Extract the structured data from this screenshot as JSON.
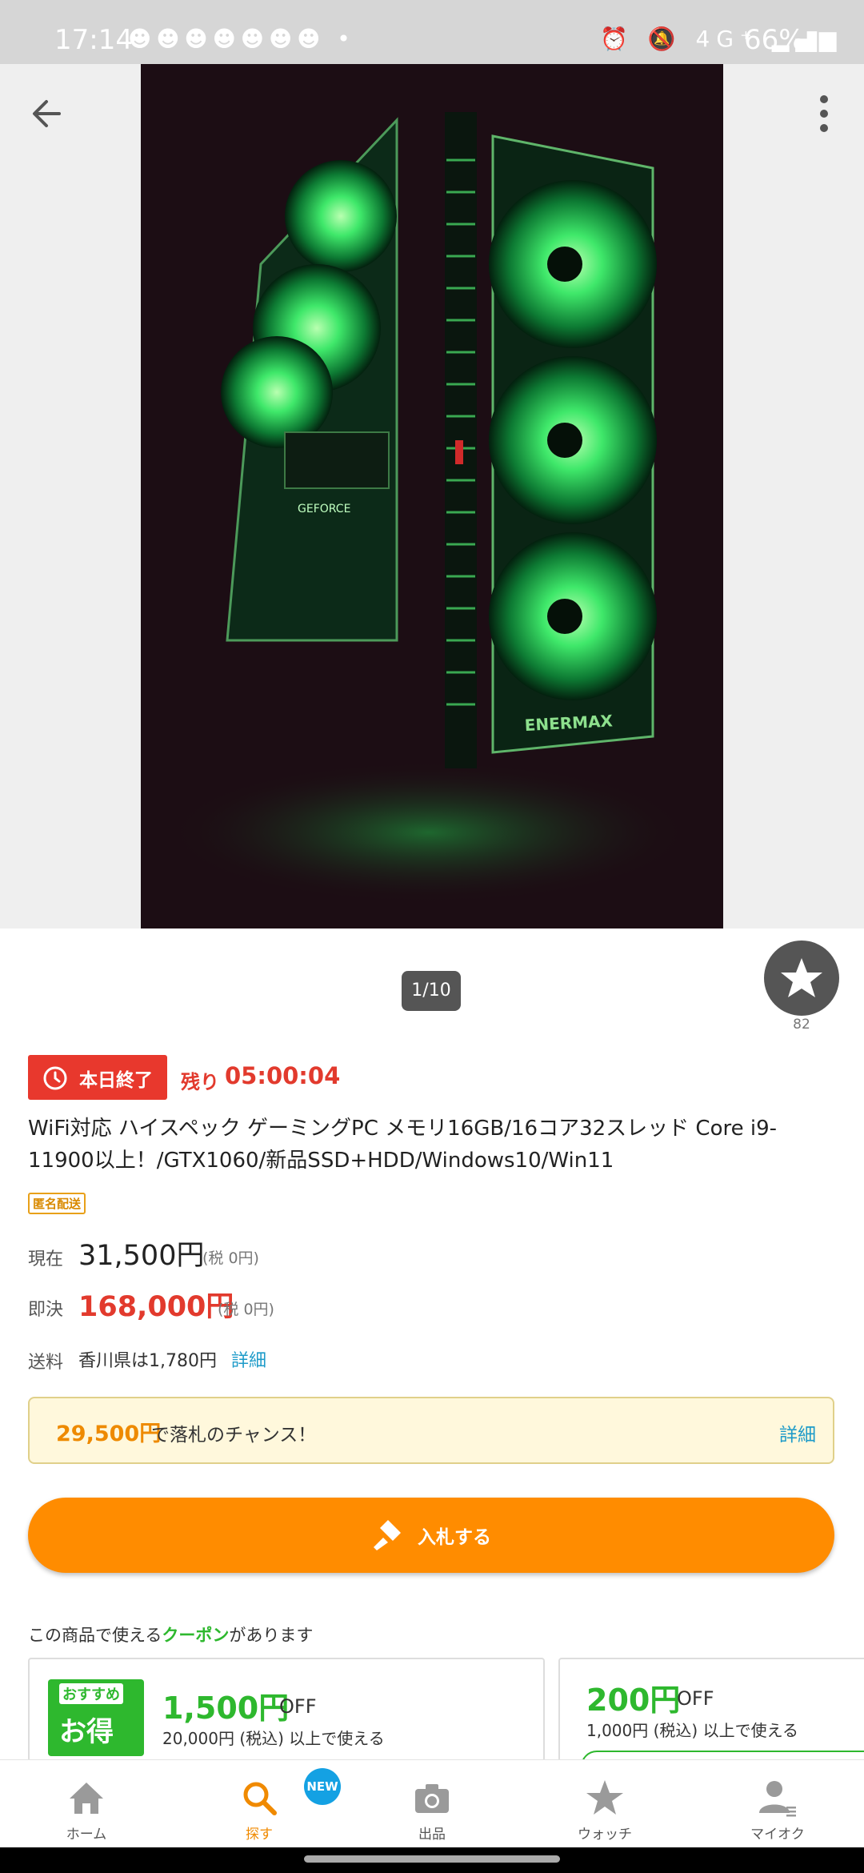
{
  "status_bar": {
    "time": "17:14",
    "notification_icons": "☻☻☻☻☻☻☻ •",
    "system_icons": "⏰ 🔕 4G⁺ ▂▄▆",
    "battery": "66%▮"
  },
  "gallery": {
    "counter": "1/10",
    "photo_caption": "ENERMAX",
    "photo_label": "GEFORCE"
  },
  "watch": {
    "count": "82"
  },
  "auction": {
    "ending_badge": "本日終了",
    "remaining_label": "残り",
    "remaining_time": "05:00:04",
    "title": "WiFi対応 ハイスペック ゲーミングPC メモリ16GB/16コア32スレッド Core i9-11900以上！/GTX1060/新品SSD+HDD/Windows10/Win11",
    "anonymous_tag": "匿名配送",
    "current_label": "現在",
    "current_price": "31,500円",
    "current_tax": "(税 0円)",
    "buyout_label": "即決",
    "buyout_price": "168,000円",
    "buyout_tax": "(税 0円)",
    "shipping_label": "送料",
    "shipping_value": "香川県は1,780円",
    "shipping_detail": "詳細"
  },
  "chance": {
    "amount": "29,500円",
    "text": "で落札のチャンス！",
    "detail": "詳細"
  },
  "bid_button": {
    "label": "入札する"
  },
  "coupons": {
    "heading_pre": "この商品で使える",
    "heading_highlight": "クーポン",
    "heading_post": "があります",
    "items": [
      {
        "badge_top": "おすすめ",
        "badge_main": "お得",
        "amount": "1,500円",
        "off": "OFF",
        "condition": "20,000円 (税込) 以上で使える"
      },
      {
        "amount": "200円",
        "off": "OFF",
        "condition": "1,000円 (税込) 以上で使える"
      }
    ]
  },
  "bottom_nav": {
    "items": [
      {
        "label": "ホーム",
        "icon": "home-icon"
      },
      {
        "label": "探す",
        "icon": "search-icon"
      },
      {
        "label": "出品",
        "icon": "camera-icon"
      },
      {
        "label": "ウォッチ",
        "icon": "star-icon"
      },
      {
        "label": "マイオク",
        "icon": "person-icon"
      }
    ],
    "new_badge": "NEW",
    "active_color": "#f08a00"
  },
  "colors": {
    "accent": "#ff8c00",
    "alert": "#e23a2d",
    "coupon": "#2eb82e",
    "link": "#1e9bc9"
  }
}
